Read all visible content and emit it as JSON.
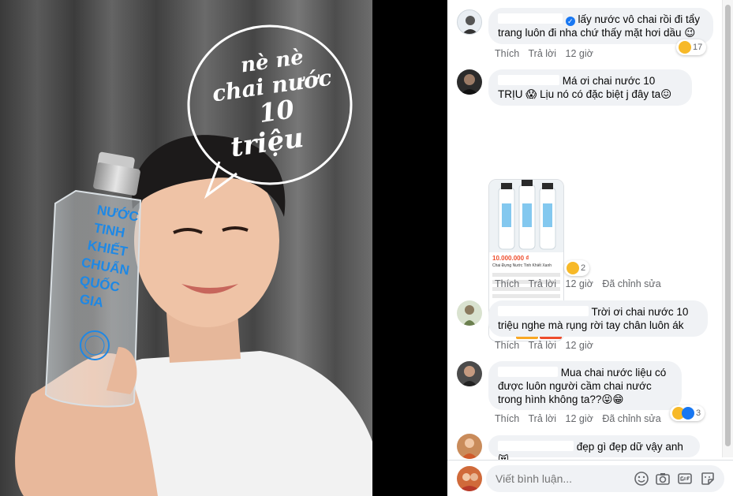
{
  "photo": {
    "speech_bubble": [
      "nè nè",
      "chai nước",
      "10",
      "triệu"
    ],
    "bottle_text": [
      "NƯỚC",
      "TINH",
      "KHIẾT",
      "CHUẨN",
      "QUỐC",
      "GIA"
    ]
  },
  "comments": [
    {
      "text": "lấy nước vô chai rồi đi tẩy trang luôn đi nha chứ thấy mặt hơi dầu 😉",
      "like": "Thích",
      "reply": "Trả lời",
      "time": "12 giờ",
      "edited": "",
      "react_count": "17",
      "verified": true
    },
    {
      "text": "Má ơi chai nước 10 TRỊU 😱 Lịu nó có đặc biệt j đây ta😖",
      "like": "Thích",
      "reply": "Trả lời",
      "time": "12 giờ",
      "edited": "Đã chỉnh sửa",
      "react_count": "2",
      "attachment": {
        "price": "10.000.000 ₫",
        "product": "Chai Đựng Nước Tinh Khiết Xanh"
      }
    },
    {
      "text": "Trời ơi chai nước 10 triệu nghe mà rụng rời tay chân luôn ák",
      "like": "Thích",
      "reply": "Trả lời",
      "time": "12 giờ",
      "edited": ""
    },
    {
      "text": "Mua chai nước liệu có được luôn người cầm chai nước trong hình không ta??😝😁",
      "like": "Thích",
      "reply": "Trả lời",
      "time": "12 giờ",
      "edited": "Đã chỉnh sửa",
      "react_count": "3"
    },
    {
      "text": "đẹp gì đẹp dữ vậy anh 😻",
      "like": "",
      "reply": "",
      "time": "",
      "edited": ""
    }
  ],
  "composer": {
    "placeholder": "Viết bình luận..."
  },
  "colors": {
    "bubble": "#f0f2f5",
    "action_text": "#65676b",
    "verified": "#1877f2",
    "bottle_blue": "#1e88e5"
  }
}
